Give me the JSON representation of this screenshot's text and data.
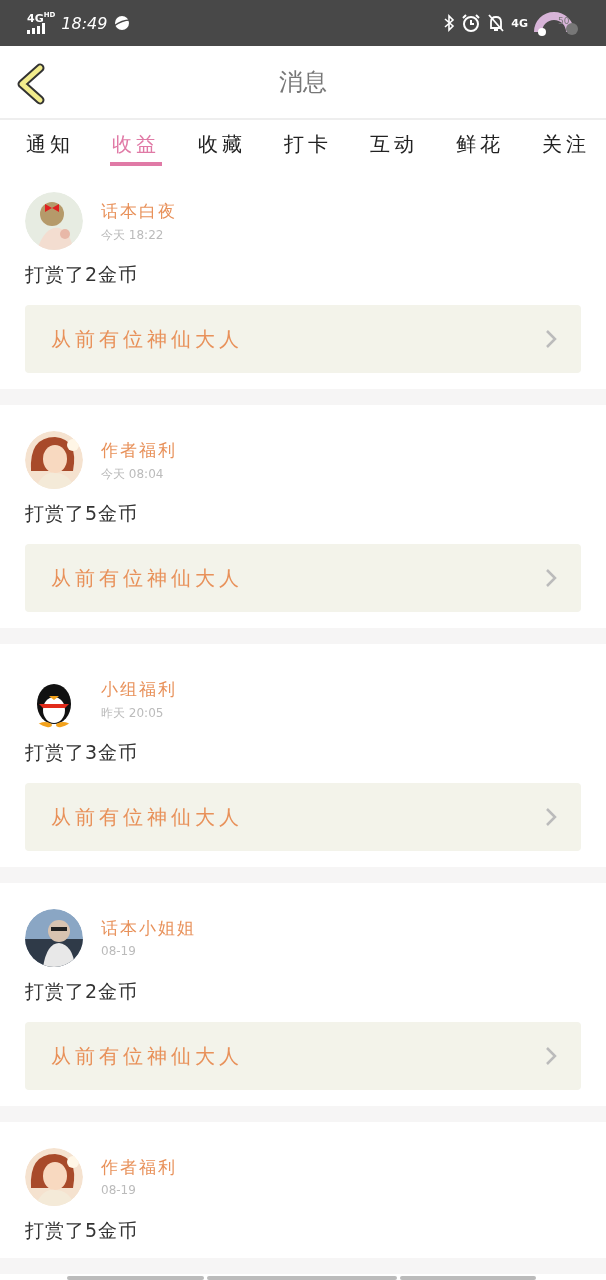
{
  "status_bar": {
    "network_left": "4G",
    "network_left_sup": "HD",
    "time": "18:49",
    "network_right": "4G",
    "battery": "50"
  },
  "header": {
    "title": "消息"
  },
  "tabs": [
    {
      "label": "通知",
      "selected": false
    },
    {
      "label": "收益",
      "selected": true
    },
    {
      "label": "收藏",
      "selected": false
    },
    {
      "label": "打卡",
      "selected": false
    },
    {
      "label": "互动",
      "selected": false
    },
    {
      "label": "鲜花",
      "selected": false
    },
    {
      "label": "关注",
      "selected": false
    }
  ],
  "messages": [
    {
      "name": "话本白夜",
      "time": "今天 18:22",
      "text": "打赏了2金币",
      "link": "从前有位神仙大人"
    },
    {
      "name": "作者福利",
      "time": "今天 08:04",
      "text": "打赏了5金币",
      "link": "从前有位神仙大人"
    },
    {
      "name": "小组福利",
      "time": "昨天 20:05",
      "text": "打赏了3金币",
      "link": "从前有位神仙大人"
    },
    {
      "name": "话本小姐姐",
      "time": "08-19",
      "text": "打赏了2金币",
      "link": "从前有位神仙大人"
    },
    {
      "name": "作者福利",
      "time": "08-19",
      "text": "打赏了5金币"
    }
  ]
}
